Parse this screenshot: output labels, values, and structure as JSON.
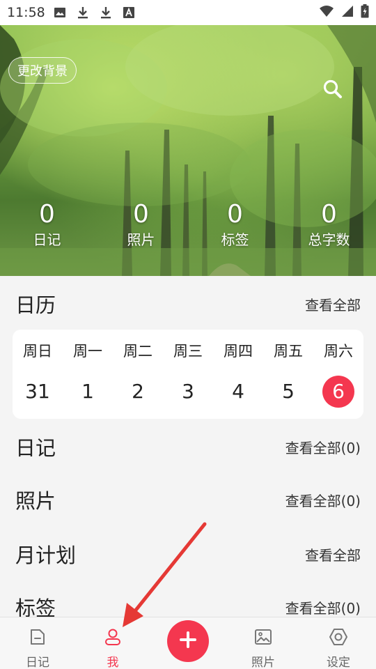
{
  "status_bar": {
    "time": "11:58"
  },
  "hero": {
    "change_background": "更改背景",
    "stats": [
      {
        "value": "0",
        "label": "日记"
      },
      {
        "value": "0",
        "label": "照片"
      },
      {
        "value": "0",
        "label": "标签"
      },
      {
        "value": "0",
        "label": "总字数"
      }
    ]
  },
  "calendar": {
    "title": "日历",
    "view_all": "查看全部",
    "weekdays": [
      "周日",
      "周一",
      "周二",
      "周三",
      "周四",
      "周五",
      "周六"
    ],
    "days": [
      "31",
      "1",
      "2",
      "3",
      "4",
      "5",
      "6"
    ],
    "today_index": 6
  },
  "diary": {
    "title": "日记",
    "view_all": "查看全部(0)"
  },
  "photos": {
    "title": "照片",
    "view_all": "查看全部(0)"
  },
  "monthly_plan": {
    "title": "月计划",
    "view_all": "查看全部"
  },
  "tags": {
    "title": "标签",
    "view_all": "查看全部(0)"
  },
  "bottom_nav": {
    "items": [
      {
        "label": "日记",
        "icon": "diary-icon"
      },
      {
        "label": "我",
        "icon": "person-icon",
        "active": true
      },
      {
        "label": "",
        "icon": "plus-icon"
      },
      {
        "label": "照片",
        "icon": "image-icon"
      },
      {
        "label": "设定",
        "icon": "settings-icon"
      }
    ]
  },
  "colors": {
    "accent": "#f4374f",
    "background": "#f4f4f4",
    "card": "#ffffff"
  }
}
